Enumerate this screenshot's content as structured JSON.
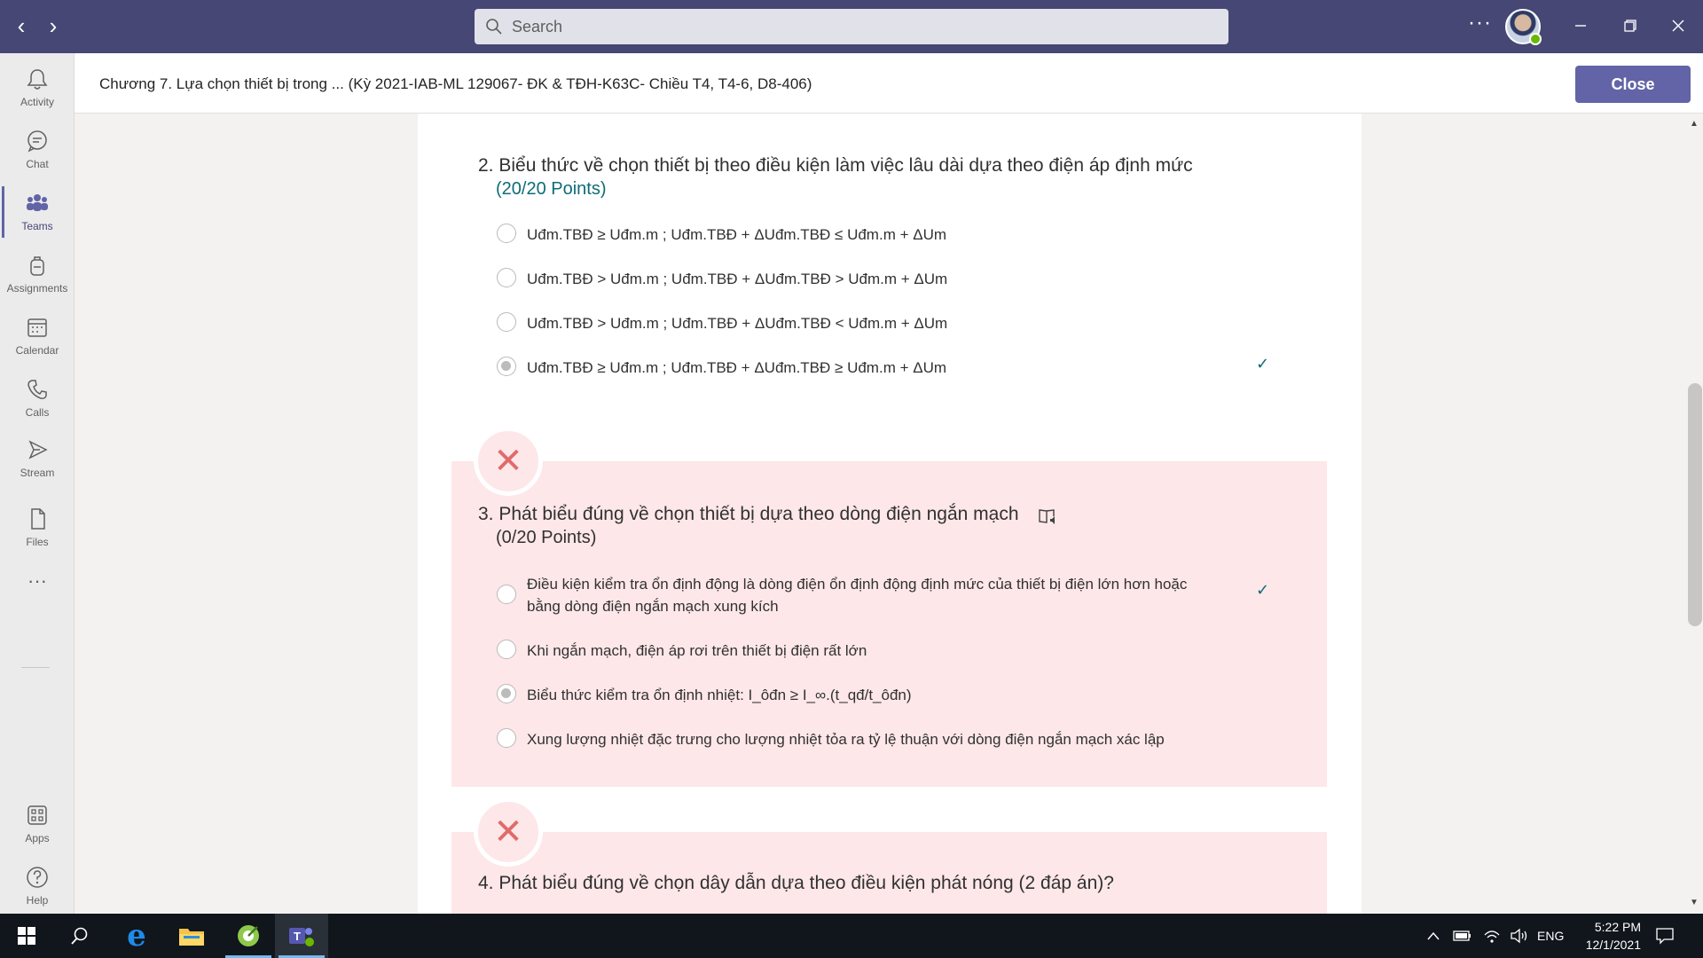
{
  "titlebar": {
    "search_placeholder": "Search",
    "more_label": "···"
  },
  "rail": {
    "items": [
      {
        "label": "Activity"
      },
      {
        "label": "Chat"
      },
      {
        "label": "Teams"
      },
      {
        "label": "Assignments"
      },
      {
        "label": "Calendar"
      },
      {
        "label": "Calls"
      },
      {
        "label": "Stream"
      },
      {
        "label": "Files"
      },
      {
        "label": "Apps"
      },
      {
        "label": "Help"
      }
    ],
    "more_label": "···"
  },
  "header": {
    "title": "Chương 7. Lựa chọn thiết bị trong ... (Kỳ 2021-IAB-ML 129067- ĐK & TĐH-K63C- Chiều T4, T4-6, D8-406)",
    "close_label": "Close"
  },
  "questions": [
    {
      "title": "2. Biểu thức về chọn thiết bị theo điều kiện làm việc lâu dài dựa theo điện áp định mức",
      "points": "(20/20 Points)",
      "options": [
        {
          "text": " Uđm.TBĐ ≥ Uđm.m ; Uđm.TBĐ + ΔUđm.TBĐ ≤ Uđm.m + ΔUm",
          "selected": false,
          "correct": false
        },
        {
          "text": "Uđm.TBĐ > Uđm.m ; Uđm.TBĐ + ΔUđm.TBĐ > Uđm.m + ΔUm",
          "selected": false,
          "correct": false
        },
        {
          "text": "Uđm.TBĐ > Uđm.m ; Uđm.TBĐ + ΔUđm.TBĐ < Uđm.m + ΔUm",
          "selected": false,
          "correct": false
        },
        {
          "text": "Uđm.TBĐ ≥ Uđm.m ; Uđm.TBĐ + ΔUđm.TBĐ ≥ Uđm.m + ΔUm",
          "selected": true,
          "correct": true
        }
      ]
    },
    {
      "title": "3. Phát biểu đúng về chọn thiết bị dựa theo dòng điện ngắn mạch",
      "points": "(0/20 Points)",
      "options": [
        {
          "text": "Điều kiện kiểm tra ổn định động là dòng điện ổn định động định mức của thiết bị điện lớn hơn hoặc bằng dòng điện ngắn mạch xung kích",
          "selected": false,
          "correct": true
        },
        {
          "text": "Khi ngắn mạch, điện áp rơi trên thiết bị điện rất lớn",
          "selected": false,
          "correct": false
        },
        {
          "text": "Biểu thức kiểm tra ổn định nhiệt: I_ôđn ≥ I_∞.(t_qđ/t_ôđn)",
          "selected": true,
          "correct": false
        },
        {
          "text": "Xung lượng nhiệt đặc trưng cho lượng nhiệt tỏa ra tỷ lệ thuận với dòng điện ngắn mạch xác lập",
          "selected": false,
          "correct": false
        }
      ]
    },
    {
      "title": "4.  Phát biểu đúng về chọn dây dẫn dựa theo điều kiện phát nóng (2 đáp án)?"
    }
  ],
  "taskbar": {
    "language": "ENG",
    "time": "5:22 PM",
    "date": "12/1/2021"
  },
  "colors": {
    "titlebar": "#464775",
    "accent": "#6264a7",
    "points": "#0e6c76",
    "wrong_bg": "#fde7e9",
    "wrong_x": "#e06b6b"
  }
}
